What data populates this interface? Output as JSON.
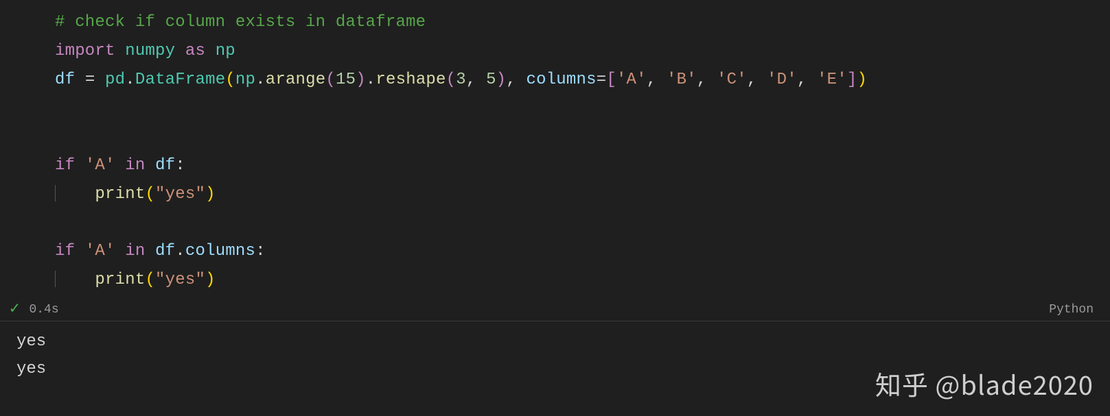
{
  "code": {
    "comment": "# check if column exists in dataframe",
    "import_kw": "import",
    "import_mod": "numpy",
    "as_kw": "as",
    "import_alias": "np",
    "df_var": "df",
    "eq": "=",
    "pd_mod": "pd",
    "dot1": ".",
    "dataframe": "DataFrame",
    "lp1": "(",
    "np_ref": "np",
    "dot2": ".",
    "arange": "arange",
    "lp2": "(",
    "n15": "15",
    "rp2": ")",
    "dot3": ".",
    "reshape": "reshape",
    "lp3": "(",
    "n3": "3",
    "comma1": ",",
    "n5": "5",
    "rp3": ")",
    "comma2": ",",
    "cols_kw": "columns",
    "eq2": "=",
    "lb1": "[",
    "sA": "'A'",
    "c_a": ",",
    "sB": "'B'",
    "c_b": ",",
    "sC": "'C'",
    "c_c": ",",
    "sD": "'D'",
    "c_d": ",",
    "sE": "'E'",
    "rb1": "]",
    "rp1": ")",
    "if_kw": "if",
    "in_kw": "in",
    "sA2": "'A'",
    "df2": "df",
    "colon": ":",
    "print_fn": "print",
    "lp_p1": "(",
    "yes_str": "\"yes\"",
    "rp_p1": ")",
    "sA3": "'A'",
    "df3": "df",
    "dot4": ".",
    "columns_attr": "columns",
    "lp_p2": "(",
    "rp_p2": ")"
  },
  "status": {
    "time": "0.4s",
    "lang": "Python"
  },
  "output": {
    "line1": "yes",
    "line2": "yes"
  },
  "watermark": "知乎 @blade2020"
}
